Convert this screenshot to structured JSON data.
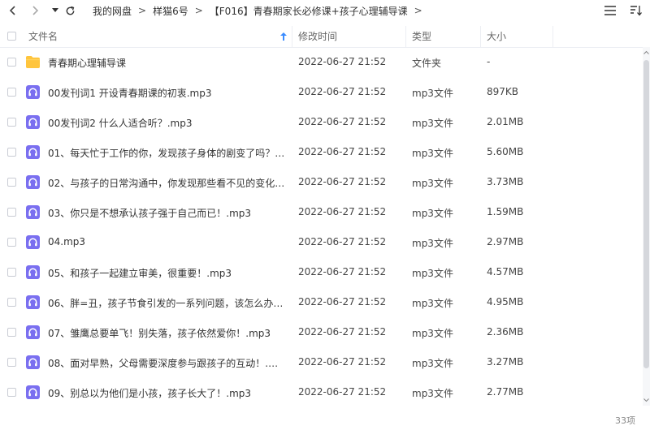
{
  "nav": {
    "breadcrumbs": [
      "我的网盘",
      "样猫6号",
      "【F016】青春期家长必修课+孩子心理辅导课"
    ]
  },
  "columns": {
    "name": "文件名",
    "time": "修改时间",
    "type": "类型",
    "size": "大小"
  },
  "files": [
    {
      "icon": "folder-icon",
      "name": "青春期心理辅导课",
      "time": "2022-06-27 21:52",
      "type": "文件夹",
      "size": "-"
    },
    {
      "icon": "audio-file-icon",
      "name": "00发刊词1 开设青春期课的初衷.mp3",
      "time": "2022-06-27 21:52",
      "type": "mp3文件",
      "size": "897KB"
    },
    {
      "icon": "audio-file-icon",
      "name": "00发刊词2 什么人适合听？.mp3",
      "time": "2022-06-27 21:52",
      "type": "mp3文件",
      "size": "2.01MB"
    },
    {
      "icon": "audio-file-icon",
      "name": "01、每天忙于工作的你，发现孩子身体的剧变了吗？.mp3",
      "time": "2022-06-27 21:52",
      "type": "mp3文件",
      "size": "5.60MB"
    },
    {
      "icon": "audio-file-icon",
      "name": "02、与孩子的日常沟通中，你发现那些看不见的变化了吗...",
      "time": "2022-06-27 21:52",
      "type": "mp3文件",
      "size": "3.73MB"
    },
    {
      "icon": "audio-file-icon",
      "name": "03、你只是不想承认孩子强于自己而已！.mp3",
      "time": "2022-06-27 21:52",
      "type": "mp3文件",
      "size": "1.59MB"
    },
    {
      "icon": "audio-file-icon",
      "name": "04.mp3",
      "time": "2022-06-27 21:52",
      "type": "mp3文件",
      "size": "2.97MB"
    },
    {
      "icon": "audio-file-icon",
      "name": "05、和孩子一起建立审美，很重要！.mp3",
      "time": "2022-06-27 21:52",
      "type": "mp3文件",
      "size": "4.57MB"
    },
    {
      "icon": "audio-file-icon",
      "name": "06、胖=丑，孩子节食引发的一系列问题，该怎么办？.m...",
      "time": "2022-06-27 21:52",
      "type": "mp3文件",
      "size": "4.95MB"
    },
    {
      "icon": "audio-file-icon",
      "name": "07、雏鹰总要单飞！别失落，孩子依然爱你！.mp3",
      "time": "2022-06-27 21:52",
      "type": "mp3文件",
      "size": "2.36MB"
    },
    {
      "icon": "audio-file-icon",
      "name": "08、面对早熟，父母需要深度参与跟孩子的互动！.mp3",
      "time": "2022-06-27 21:52",
      "type": "mp3文件",
      "size": "3.27MB"
    },
    {
      "icon": "audio-file-icon",
      "name": "09、别总以为他们是小孩，孩子长大了！.mp3",
      "time": "2022-06-27 21:52",
      "type": "mp3文件",
      "size": "2.77MB"
    }
  ],
  "footer": {
    "count": "33项"
  },
  "colors": {
    "accent": "#3b8cff",
    "audio_icon": "#7a6ff0",
    "folder": "#ffc53d"
  }
}
